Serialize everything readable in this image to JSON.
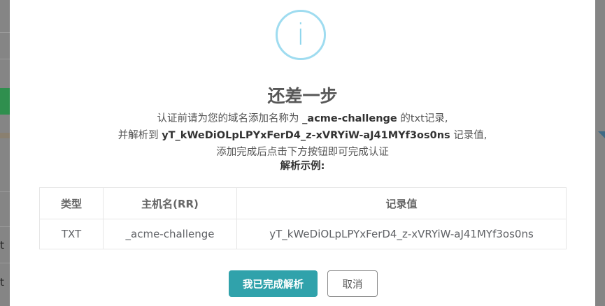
{
  "background": {
    "row_letters": [
      "t",
      "t"
    ]
  },
  "dialog": {
    "icon": "info-icon",
    "icon_glyph": "i",
    "title": "还差一步",
    "line1_pre": "认证前请为您的域名添加名称为",
    "line1_name": "_acme-challenge",
    "line1_post": "的txt记录,",
    "line2_pre": "并解析到",
    "line2_value": "yT_kWeDiOLpLPYxFerD4_z-xVRYiW-aJ41MYf3os0ns",
    "line2_post": "记录值,",
    "line3": "添加完成后点击下方按钮即可完成认证",
    "example_label": "解析示例:",
    "table": {
      "headers": [
        "类型",
        "主机名(RR)",
        "记录值"
      ],
      "rows": [
        [
          "TXT",
          "_acme-challenge",
          "yT_kWeDiOLpLPYxFerD4_z-xVRYiW-aJ41MYf3os0ns"
        ]
      ]
    },
    "confirm_label": "我已完成解析",
    "cancel_label": "取消"
  },
  "colors": {
    "confirm": "#30a2ab",
    "icon_ring": "#9fdcf0",
    "overlay": "#7d7d7d"
  }
}
